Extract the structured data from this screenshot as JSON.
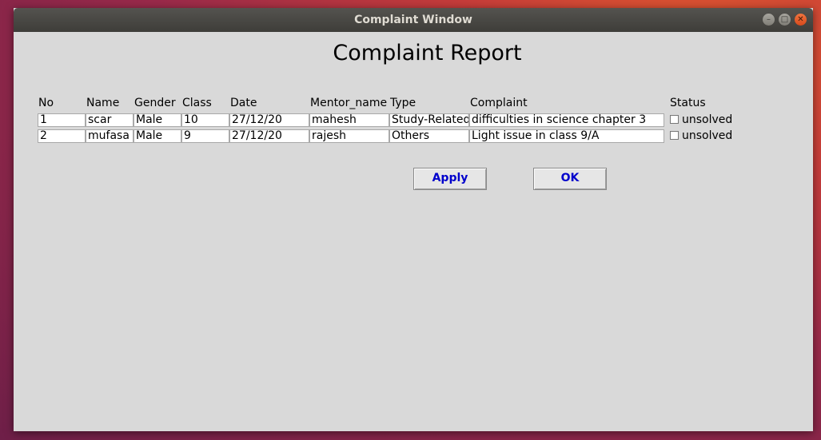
{
  "window": {
    "title": "Complaint Window",
    "minimize_glyph": "–",
    "maximize_glyph": "□",
    "close_glyph": "✕"
  },
  "report": {
    "title": "Complaint Report"
  },
  "table": {
    "columns": [
      "No",
      "Name",
      "Gender",
      "Class",
      "Date",
      "Mentor_name",
      "Type",
      "Complaint",
      "Status"
    ],
    "rows": [
      {
        "no": "1",
        "name": "scar",
        "gender": "Male",
        "class": "10",
        "date": "27/12/20",
        "mentor": "mahesh",
        "type": "Study-Related",
        "complaint": "difficulties in science chapter 3",
        "status": "unsolved",
        "checked": false
      },
      {
        "no": "2",
        "name": "mufasa",
        "gender": "Male",
        "class": "9",
        "date": "27/12/20",
        "mentor": "rajesh",
        "type": "Others",
        "complaint": "Light issue in class 9/A",
        "status": "unsolved",
        "checked": false
      }
    ]
  },
  "buttons": {
    "apply": "Apply",
    "ok": "OK"
  },
  "colors": {
    "button_text": "#0000cc",
    "window_bg": "#d9d9d9",
    "titlebar": "#3e3d39",
    "close_button": "#e0582e"
  }
}
